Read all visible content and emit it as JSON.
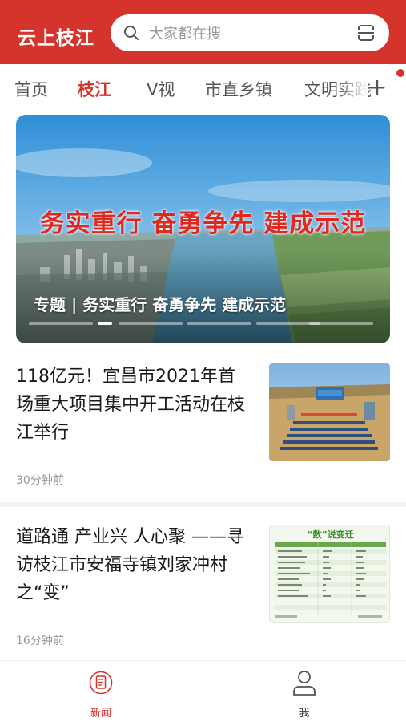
{
  "header": {
    "app_title": "云上枝江",
    "search_placeholder": "大家都在搜",
    "brand_color": "#d4342c"
  },
  "tabs": [
    {
      "label": "首页",
      "active": false
    },
    {
      "label": "枝江",
      "active": true
    },
    {
      "label": "V视",
      "active": false
    },
    {
      "label": "市直乡镇",
      "active": false
    },
    {
      "label": "文明实践",
      "active": false
    }
  ],
  "banner": {
    "headline": "务实重行  奋勇争先  建成示范",
    "caption": "专题 | 务实重行 奋勇争先 建成示范",
    "slide_count": 6,
    "active_slide": 1
  },
  "articles": [
    {
      "title": "118亿元！宜昌市2021年首场重大项目集中开工活动在枝江举行",
      "time": "30分钟前"
    },
    {
      "title": "道路通 产业兴 人心聚 ——寻访枝江市安福寺镇刘家冲村之“变”",
      "time": "16分钟前",
      "thumb_title": "“数”说变迁"
    }
  ],
  "bottom_nav": [
    {
      "label": "新闻",
      "icon": "news-icon",
      "active": true
    },
    {
      "label": "我",
      "icon": "user-icon",
      "active": false
    }
  ]
}
